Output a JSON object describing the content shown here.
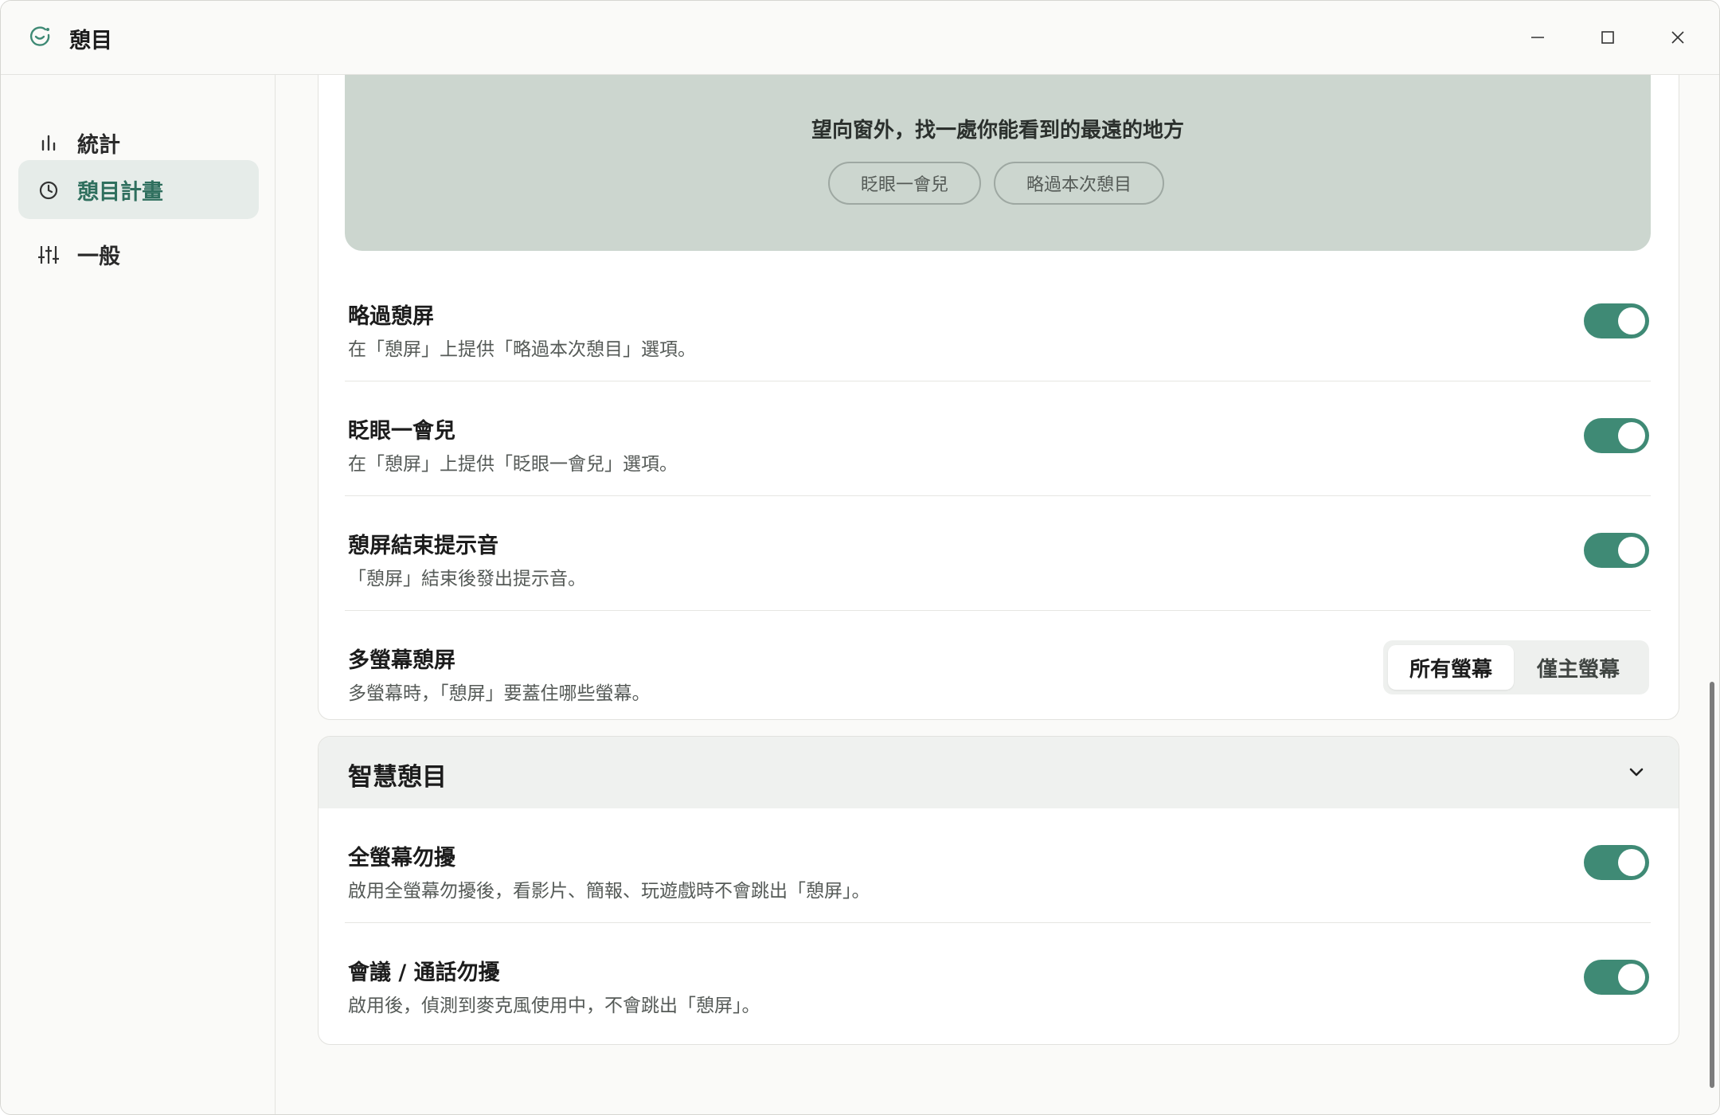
{
  "window": {
    "title": "憩目"
  },
  "sidebar": {
    "items": [
      {
        "label": "統計",
        "icon": "bar-chart-icon"
      },
      {
        "label": "憩目計畫",
        "icon": "clock-icon"
      },
      {
        "label": "一般",
        "icon": "sliders-icon"
      }
    ]
  },
  "preview": {
    "message": "望向窗外，找一處你能看到的最遠的地方",
    "snooze_label": "眨眼一會兒",
    "skip_label": "略過本次憩目"
  },
  "break_settings": [
    {
      "title": "略過憩屏",
      "description": "在「憩屏」上提供「略過本次憩目」選項。",
      "enabled": true
    },
    {
      "title": "眨眼一會兒",
      "description": "在「憩屏」上提供「眨眼一會兒」選項。",
      "enabled": true
    },
    {
      "title": "憩屏結束提示音",
      "description": "「憩屏」結束後發出提示音。",
      "enabled": true
    }
  ],
  "multi_screen": {
    "title": "多螢幕憩屏",
    "description": "多螢幕時，「憩屏」要蓋住哪些螢幕。",
    "options": [
      "所有螢幕",
      "僅主螢幕"
    ],
    "selected": "所有螢幕"
  },
  "smart_break": {
    "section_title": "智慧憩目",
    "items": [
      {
        "title": "全螢幕勿擾",
        "description": "啟用全螢幕勿擾後，看影片、簡報、玩遊戲時不會跳出「憩屏」。",
        "enabled": true
      },
      {
        "title": "會議 / 通話勿擾",
        "description": "啟用後，偵測到麥克風使用中，不會跳出「憩屏」。",
        "enabled": true
      }
    ]
  },
  "colors": {
    "accent": "#3f8a75",
    "active_nav_bg": "#e6ece9",
    "preview_bg": "#ccd6cf"
  }
}
